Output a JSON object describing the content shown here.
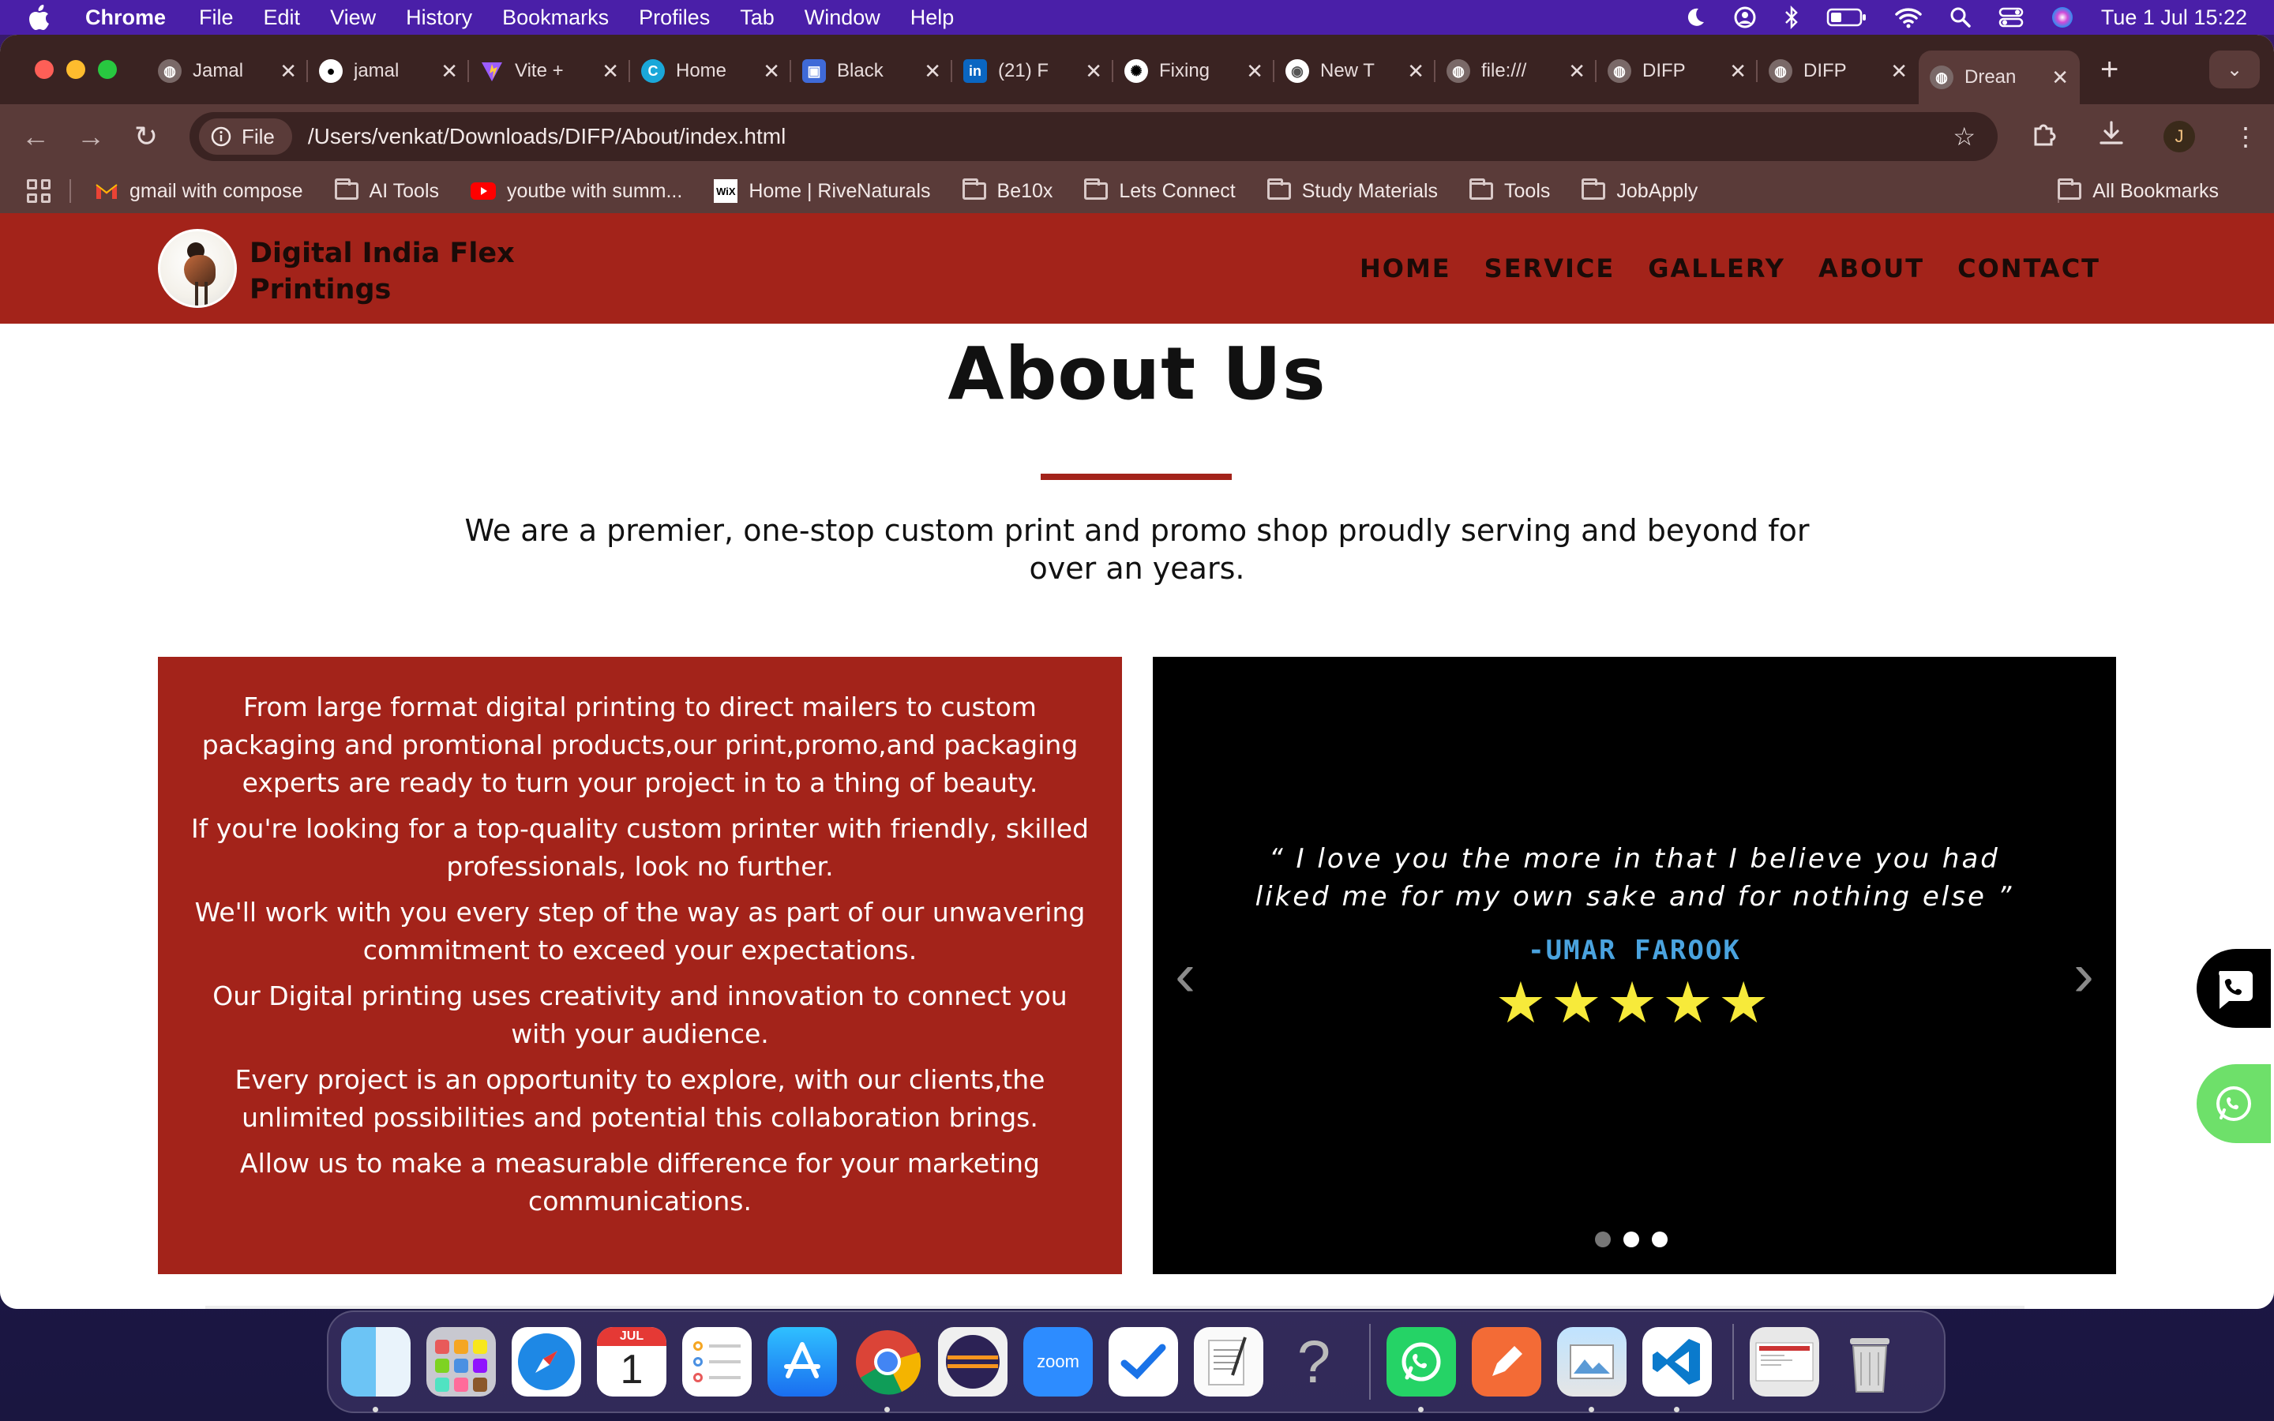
{
  "menubar": {
    "app": "Chrome",
    "items": [
      "File",
      "Edit",
      "View",
      "History",
      "Bookmarks",
      "Profiles",
      "Tab",
      "Window",
      "Help"
    ],
    "clock": "Tue 1 Jul  15:22"
  },
  "tabs": [
    {
      "title": "Jamal",
      "icon": "globe-icon"
    },
    {
      "title": "jamal",
      "icon": "github-icon"
    },
    {
      "title": "Vite +",
      "icon": "vite-icon"
    },
    {
      "title": "Home",
      "icon": "canva-icon"
    },
    {
      "title": "Black",
      "icon": "blackbox-icon"
    },
    {
      "title": "(21) F",
      "icon": "linkedin-icon"
    },
    {
      "title": "Fixing",
      "icon": "openai-icon"
    },
    {
      "title": "New T",
      "icon": "chrome-icon"
    },
    {
      "title": "file:///",
      "icon": "globe-icon"
    },
    {
      "title": "DIFP",
      "icon": "globe-icon"
    },
    {
      "title": "DIFP",
      "icon": "globe-icon"
    },
    {
      "title": "Drean",
      "icon": "globe-icon",
      "active": true
    }
  ],
  "omnibox": {
    "chip_label": "File",
    "url": "/Users/venkat/Downloads/DIFP/About/index.html"
  },
  "profile_initial": "J",
  "bookmarks": [
    {
      "label": "gmail with compose",
      "icon": "gmail-icon"
    },
    {
      "label": "AI Tools",
      "icon": "folder-icon"
    },
    {
      "label": "youtbe with summ...",
      "icon": "youtube-icon"
    },
    {
      "label": "Home | RiveNaturals",
      "icon": "wix-icon"
    },
    {
      "label": "Be10x",
      "icon": "folder-icon"
    },
    {
      "label": "Lets Connect",
      "icon": "folder-icon"
    },
    {
      "label": "Study Materials",
      "icon": "folder-icon"
    },
    {
      "label": "Tools",
      "icon": "folder-icon"
    },
    {
      "label": "JobApply",
      "icon": "folder-icon"
    }
  ],
  "all_bookmarks": "All Bookmarks",
  "site": {
    "brand_line1": "Digital India Flex",
    "brand_line2": "Printings",
    "nav": [
      "HOME",
      "SERVICE",
      "GALLERY",
      "ABOUT",
      "CONTACT"
    ],
    "about_title": "About Us",
    "intro": "We are a premier, one-stop custom print and promo shop proudly serving and beyond for over an years.",
    "paragraphs": [
      "From large format digital printing to direct mailers to custom packaging and promtional products,our print,promo,and packaging experts are ready to turn your project in to a thing of beauty.",
      "If you're looking for a top-quality custom printer with friendly, skilled professionals, look no further.",
      "We'll work with you every step of the way as part of our unwavering commitment to exceed your expectations.",
      "Our Digital printing uses creativity and innovation to connect you with your audience.",
      "Every project is an opportunity to explore, with our clients,the unlimited possibilities and potential this collaboration brings.",
      "Allow us to make a measurable difference for your marketing communications."
    ],
    "testimonial": {
      "quote": "“ I love you the more in that I believe you had liked me for my own sake and for nothing else ”",
      "author": "-UMAR FAROOK",
      "stars": "★★★★★",
      "rating": 5,
      "prev": "‹",
      "next": "›",
      "active_slide": 1,
      "slide_count": 3
    }
  },
  "dock": [
    "Finder",
    "Launchpad",
    "Safari",
    "Calendar",
    "Reminders",
    "App Store",
    "Chrome",
    "Eclipse",
    "Zoom",
    "Tasks",
    "TextEdit",
    "Help",
    "WhatsApp",
    "Pen",
    "Preview",
    "VS Code",
    "Screenshot",
    "Trash"
  ],
  "calendar_month": "JUL",
  "calendar_day": "1",
  "zoom_label": "zoom",
  "colors": {
    "header_red": "#a3231a",
    "testimonial_bg": "#000000",
    "author_blue": "#4aa3df",
    "star_yellow": "#f7ea3a",
    "menubar_purple": "#4a1fa8",
    "chrome_frame": "#3a2322"
  }
}
